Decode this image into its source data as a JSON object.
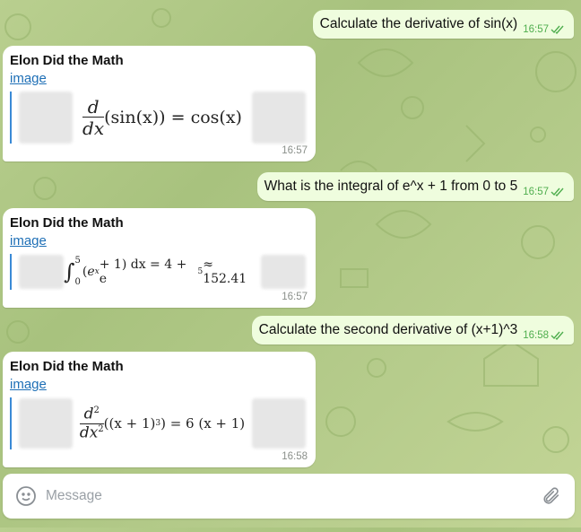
{
  "chat": {
    "messages": [
      {
        "dir": "out",
        "text": "Calculate the derivative of sin(x)",
        "time": "16:57"
      },
      {
        "dir": "in",
        "sender": "Elon Did the Math",
        "link": "image",
        "time": "16:57",
        "formula": {
          "lhs_num": "d",
          "lhs_den": "dx",
          "expr": "(sin(x)) = cos(x)"
        }
      },
      {
        "dir": "out",
        "text": "What is the integral of e^x + 1 from 0 to 5",
        "time": "16:57"
      },
      {
        "dir": "in",
        "sender": "Elon Did the Math",
        "link": "image",
        "time": "16:57",
        "formula": {
          "upper": "5",
          "lower": "0",
          "base": "e",
          "exp_x": "x",
          "tail": " + 1) dx = 4 + e",
          "exp5": "5",
          "approx": " ≈ 152.41"
        }
      },
      {
        "dir": "out",
        "text": "Calculate the second derivative of (x+1)^3",
        "time": "16:58"
      },
      {
        "dir": "in",
        "sender": "Elon Did the Math",
        "link": "image",
        "time": "16:58",
        "formula": {
          "d2": "d",
          "sup2": "2",
          "dx2": "dx",
          "inner_a": "((x + 1)",
          "cube": "3",
          "inner_b": ") = 6 (x + 1)"
        }
      }
    ]
  },
  "composer": {
    "placeholder": "Message"
  },
  "icons": {
    "emoji": "emoji-smile-icon",
    "attach": "paperclip-icon",
    "read": "double-check-icon"
  },
  "colors": {
    "out_bubble": "#effdde",
    "in_bubble": "#ffffff",
    "link": "#1e6fb6",
    "read_check": "#4fae4e"
  }
}
